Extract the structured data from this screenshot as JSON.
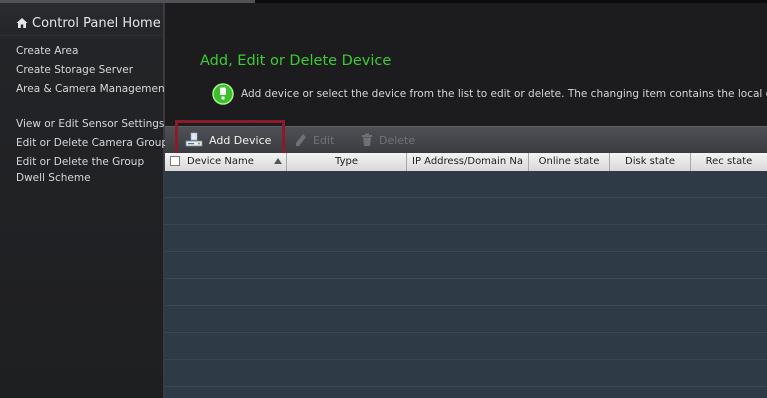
{
  "sidebar": {
    "home_label": "Control Panel Home",
    "items": [
      {
        "label": "Create Area"
      },
      {
        "label": "Create Storage Server"
      },
      {
        "label": "Area & Camera Management"
      },
      {
        "label": "View or Edit Sensor Settings"
      },
      {
        "label": "Edit or Delete Camera Group"
      },
      {
        "label": "Edit or Delete the Group"
      },
      {
        "label": "Dwell Scheme"
      }
    ]
  },
  "main": {
    "title": "Add, Edit or Delete Device",
    "description": "Add device or select the device from the list to edit or delete. The changing item contains the local c",
    "toolbar": {
      "add_label": "Add Device",
      "edit_label": "Edit",
      "delete_label": "Delete"
    },
    "table": {
      "columns": [
        "Device Name",
        "Type",
        "IP Address/Domain Na",
        "Online state",
        "Disk state",
        "Rec state"
      ],
      "rows": []
    }
  },
  "colors": {
    "title_green": "#3ccc32",
    "highlight_red": "#8b1a2a",
    "table_body": "#2e3a45"
  }
}
